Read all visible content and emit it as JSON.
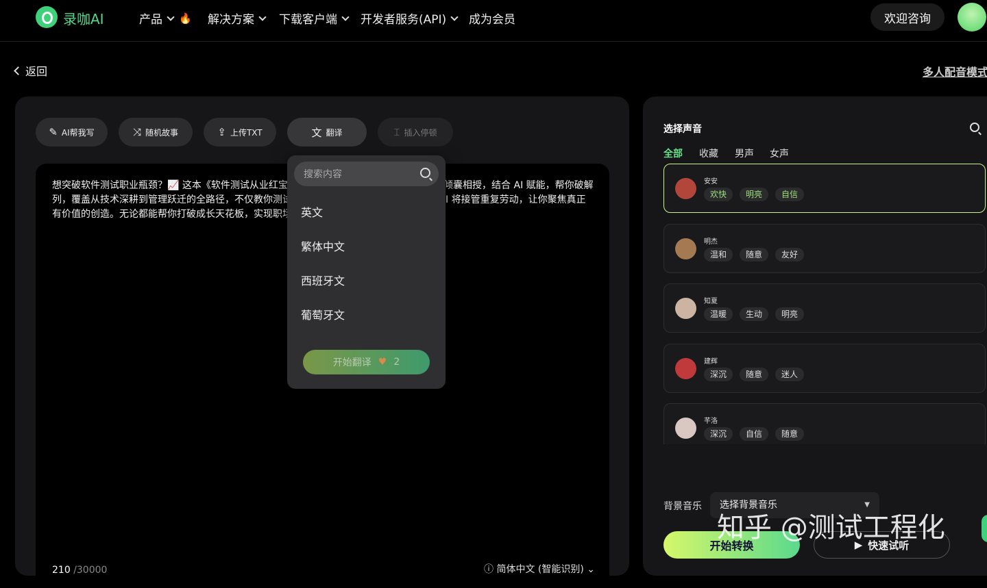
{
  "nav": {
    "brand": "录咖AI",
    "items": [
      "产品",
      "解决方案",
      "下载客户端",
      "开发者服务(API)",
      "成为会员"
    ],
    "consult": "欢迎咨询"
  },
  "page": {
    "back": "返回",
    "multi_mode": "多人配音模式"
  },
  "toolbar": {
    "ai_write": "AI帮我写",
    "random_story": "随机故事",
    "upload_txt": "上传TXT",
    "translate": "翻译",
    "insert_pause": "插入停顿"
  },
  "editor": {
    "text": "想突破软件测试职业瓶颈？📈 这本《软件测试从业红宝书》局指南！ 从业 20 余年的双专家倾囊相授，结合 AI 赋能，帮你破解列，覆盖从技术深耕到管理跃迁的全路径，不仅教你测试硬技能，更传授沟通、协作、影响 AI 将接管重复劳动，让你聚焦真正有价值的创造。无论都能帮你打破成长天花板，实现职场跨越式发展。",
    "count": "210",
    "max": "/30000",
    "language": "ⓘ 简体中文 (智能识别) ⌄"
  },
  "translate_dropdown": {
    "search_placeholder": "搜索内容",
    "options": [
      "英文",
      "繁体中文",
      "西班牙文",
      "葡萄牙文"
    ],
    "start_label": "开始翻译",
    "cost": "2"
  },
  "voice": {
    "title": "选择声音",
    "tabs": [
      "全部",
      "收藏",
      "男声",
      "女声"
    ],
    "cards": [
      {
        "name": "安安",
        "tags": [
          "欢快",
          "明亮",
          "自信"
        ],
        "color": "#b3463a"
      },
      {
        "name": "明杰",
        "tags": [
          "温和",
          "随意",
          "友好"
        ],
        "color": "#a57a53"
      },
      {
        "name": "知夏",
        "tags": [
          "温暖",
          "生动",
          "明亮"
        ],
        "color": "#cdb4a2"
      },
      {
        "name": "建辉",
        "tags": [
          "深沉",
          "随意",
          "迷人"
        ],
        "color": "#c0393b"
      },
      {
        "name": "芊洛",
        "tags": [
          "深沉",
          "自信",
          "随意"
        ],
        "color": "#d9c7c2"
      }
    ],
    "bgm_label": "背景音乐",
    "bgm_placeholder": "选择背景音乐",
    "convert": "开始转换",
    "preview": "快速试听"
  },
  "watermark": "知乎 @测试工程化"
}
